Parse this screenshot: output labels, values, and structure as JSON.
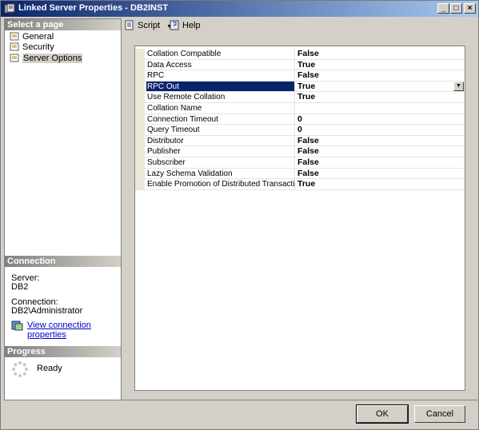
{
  "window": {
    "title": "Linked Server Properties - DB2INST",
    "min": "_",
    "max": "□",
    "close": "×"
  },
  "left": {
    "select_header": "Select a page",
    "pages": [
      {
        "label": "General"
      },
      {
        "label": "Security"
      },
      {
        "label": "Server Options"
      }
    ],
    "connection_header": "Connection",
    "server_label": "Server:",
    "server_value": "DB2",
    "connection_label": "Connection:",
    "connection_value": "DB2\\Administrator",
    "view_connection_link": "View connection properties",
    "progress_header": "Progress",
    "progress_status": "Ready"
  },
  "toolbar": {
    "script_label": "Script",
    "help_label": "Help"
  },
  "grid": {
    "rows": [
      {
        "name": "Collation Compatible",
        "value": "False"
      },
      {
        "name": "Data Access",
        "value": "True"
      },
      {
        "name": "RPC",
        "value": "False"
      },
      {
        "name": "RPC Out",
        "value": "True"
      },
      {
        "name": "Use Remote Collation",
        "value": "True"
      },
      {
        "name": "Collation Name",
        "value": ""
      },
      {
        "name": "Connection Timeout",
        "value": "0"
      },
      {
        "name": "Query Timeout",
        "value": "0"
      },
      {
        "name": "Distributor",
        "value": "False"
      },
      {
        "name": "Publisher",
        "value": "False"
      },
      {
        "name": "Subscriber",
        "value": "False"
      },
      {
        "name": "Lazy Schema Validation",
        "value": "False"
      },
      {
        "name": "Enable Promotion of Distributed Transactions f",
        "value": "True"
      }
    ]
  },
  "buttons": {
    "ok": "OK",
    "cancel": "Cancel"
  }
}
